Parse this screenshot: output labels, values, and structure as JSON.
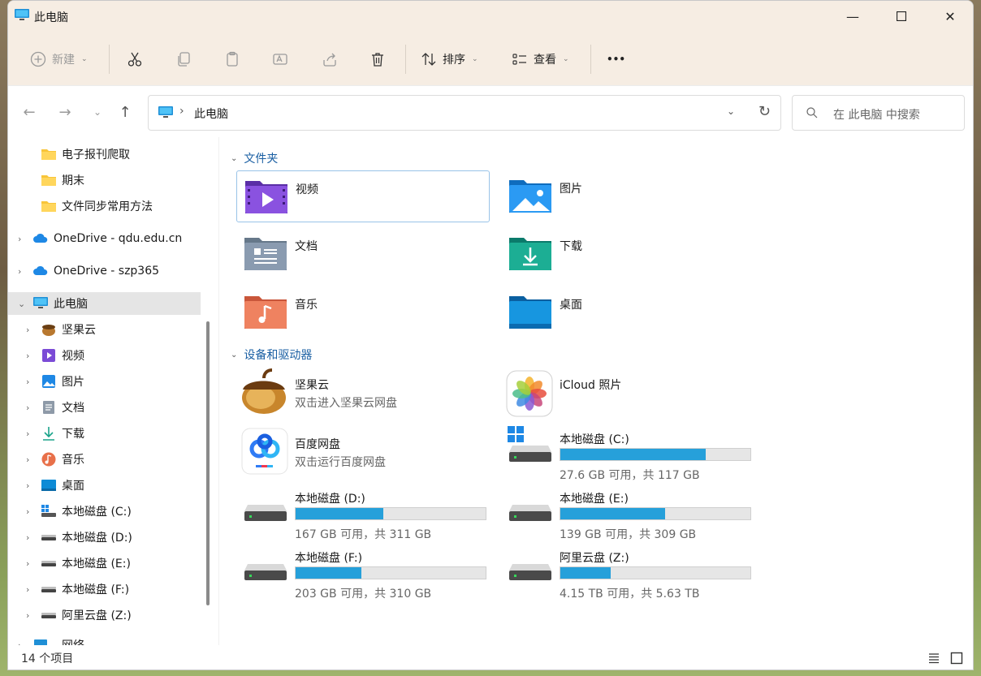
{
  "window": {
    "title": "此电脑"
  },
  "toolbar": {
    "new_label": "新建",
    "sort_label": "排序",
    "view_label": "查看",
    "more_label": "•••"
  },
  "address": {
    "path": "此电脑",
    "search_placeholder": "在 此电脑 中搜索"
  },
  "sidebar": {
    "items": [
      {
        "label": "电子报刊爬取",
        "icon": "folder-icon"
      },
      {
        "label": "期末",
        "icon": "folder-icon"
      },
      {
        "label": "文件同步常用方法",
        "icon": "folder-icon"
      },
      {
        "label": "OneDrive - qdu.edu.cn",
        "icon": "cloud-icon"
      },
      {
        "label": "OneDrive - szp365",
        "icon": "cloud-icon"
      },
      {
        "label": "此电脑",
        "icon": "pc-icon"
      },
      {
        "label": "坚果云",
        "icon": "nut-icon"
      },
      {
        "label": "视频",
        "icon": "video-icon"
      },
      {
        "label": "图片",
        "icon": "picture-icon"
      },
      {
        "label": "文档",
        "icon": "document-icon"
      },
      {
        "label": "下载",
        "icon": "download-icon"
      },
      {
        "label": "音乐",
        "icon": "music-icon"
      },
      {
        "label": "桌面",
        "icon": "desktop-icon"
      },
      {
        "label": "本地磁盘 (C:)",
        "icon": "windows-drive-icon"
      },
      {
        "label": "本地磁盘 (D:)",
        "icon": "drive-icon"
      },
      {
        "label": "本地磁盘 (E:)",
        "icon": "drive-icon"
      },
      {
        "label": "本地磁盘 (F:)",
        "icon": "drive-icon"
      },
      {
        "label": "阿里云盘 (Z:)",
        "icon": "drive-icon"
      },
      {
        "label": "网络",
        "icon": "network-icon"
      }
    ]
  },
  "main": {
    "folders_heading": "文件夹",
    "folders": [
      {
        "name": "视频"
      },
      {
        "name": "图片"
      },
      {
        "name": "文档"
      },
      {
        "name": "下载"
      },
      {
        "name": "音乐"
      },
      {
        "name": "桌面"
      }
    ],
    "devices_heading": "设备和驱动器",
    "devices": [
      {
        "name": "坚果云",
        "sub": "双击进入坚果云网盘"
      },
      {
        "name": "iCloud 照片",
        "sub": ""
      },
      {
        "name": "百度网盘",
        "sub": "双击运行百度网盘"
      }
    ],
    "drives": [
      {
        "name": "本地磁盘 (C:)",
        "free": "27.6 GB 可用，共 117 GB",
        "used_fraction": 0.764
      },
      {
        "name": "本地磁盘 (D:)",
        "free": "167 GB 可用，共 311 GB",
        "used_fraction": 0.463
      },
      {
        "name": "本地磁盘 (E:)",
        "free": "139 GB 可用，共 309 GB",
        "used_fraction": 0.55
      },
      {
        "name": "本地磁盘 (F:)",
        "free": "203 GB 可用，共 310 GB",
        "used_fraction": 0.345
      },
      {
        "name": "阿里云盘 (Z:)",
        "free": "4.15 TB 可用，共 5.63 TB",
        "used_fraction": 0.263
      }
    ]
  },
  "status": {
    "count": "14 个项目"
  },
  "colors": {
    "accent": "#26a0da",
    "heading": "#1a5fa3",
    "chrome": "#f6ede3"
  }
}
